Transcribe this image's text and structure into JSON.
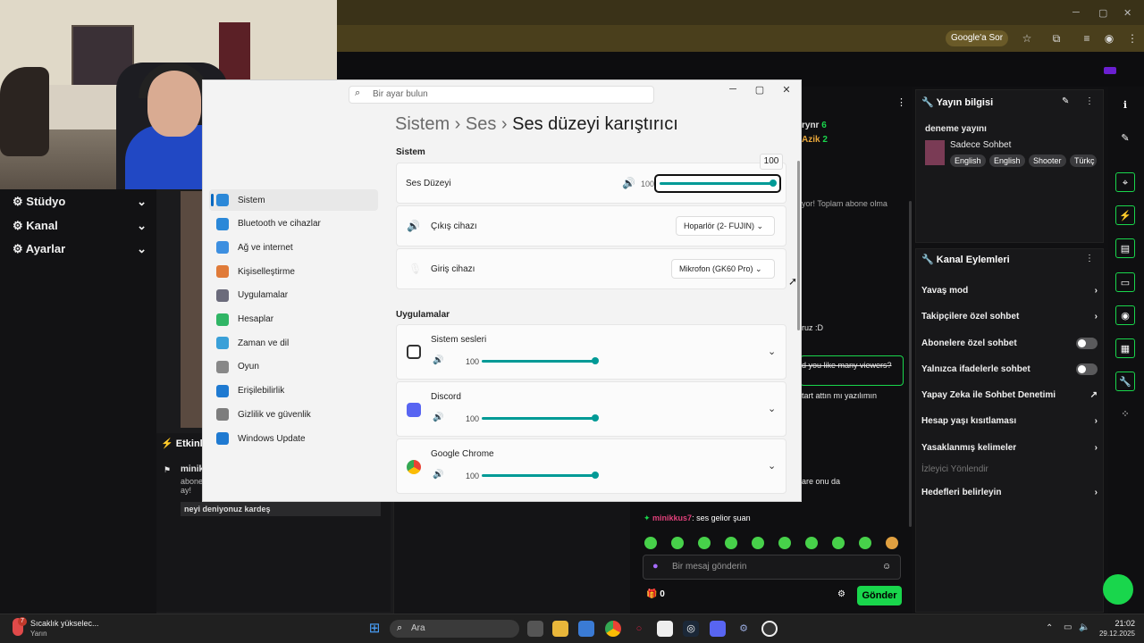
{
  "browser": {
    "ask_google": "Google'a Sor"
  },
  "left_nav": {
    "items": [
      {
        "label": "Stüdyo"
      },
      {
        "label": "Kanal"
      },
      {
        "label": "Ayarlar"
      }
    ]
  },
  "events": {
    "title": "Etkinlik",
    "user": "minik",
    "text": "abone ay!",
    "message": "neyi deniyonuz kardeş"
  },
  "chat": {
    "partial_url": "com",
    "top_users": [
      {
        "name": "rynr",
        "count": "6"
      },
      {
        "name": "Azik",
        "count": "2"
      }
    ],
    "lines": [
      "yor! Toplam abone olma",
      "ruz :D",
      "d you like many viewers?",
      "tart attın mı yazılımın",
      "are onu da",
      "gelior"
    ],
    "last_user": "minikkus7",
    "last_msg": ": ses gelior şuan",
    "input_placeholder": "Bir mesaj gönderin",
    "points": "0",
    "send": "Gönder"
  },
  "stream_info": {
    "title": "Yayın bilgisi",
    "stream_title": "deneme yayını",
    "category": "Sadece Sohbet",
    "tags": [
      "English",
      "English",
      "Shooter",
      "Türkç"
    ]
  },
  "channel_actions": {
    "title": "Kanal Eylemleri",
    "rows": [
      {
        "label": "Yavaş mod",
        "control": "arrow"
      },
      {
        "label": "Takipçilere özel sohbet",
        "control": "arrow"
      },
      {
        "label": "Abonelere özel sohbet",
        "control": "toggle"
      },
      {
        "label": "Yalnızca ifadelerle sohbet",
        "control": "toggle"
      },
      {
        "label": "Yapay Zeka ile Sohbet Denetimi",
        "control": "external"
      },
      {
        "label": "Hesap yaşı kısıtlaması",
        "control": "arrow"
      },
      {
        "label": "Yasaklanmış kelimeler",
        "control": "arrow"
      }
    ],
    "section": "İzleyici Yönlendir",
    "goal": "Hedefleri belirleyin"
  },
  "settings": {
    "search_placeholder": "Bir ayar bulun",
    "breadcrumb": [
      "Sistem",
      "Ses",
      "Ses düzeyi karıştırıcı"
    ],
    "sidebar": [
      {
        "label": "Sistem",
        "color": "#2b88d8"
      },
      {
        "label": "Bluetooth ve cihazlar",
        "color": "#2b88d8"
      },
      {
        "label": "Ağ ve internet",
        "color": "#3d8fe0"
      },
      {
        "label": "Kişiselleştirme",
        "color": "#e07b39"
      },
      {
        "label": "Uygulamalar",
        "color": "#6b6b7b"
      },
      {
        "label": "Hesaplar",
        "color": "#30b565"
      },
      {
        "label": "Zaman ve dil",
        "color": "#3aa0d8"
      },
      {
        "label": "Oyun",
        "color": "#888"
      },
      {
        "label": "Erişilebilirlik",
        "color": "#1f7ad1"
      },
      {
        "label": "Gizlilik ve güvenlik",
        "color": "#7d7d7d"
      },
      {
        "label": "Windows Update",
        "color": "#1f7ad1"
      }
    ],
    "system_section": "Sistem",
    "master_volume": {
      "label": "Ses Düzeyi",
      "value": "100",
      "tooltip": "100",
      "level": 1.0
    },
    "output": {
      "label": "Çıkış cihazı",
      "value": "Hoparlör (2- FUJIN)"
    },
    "input": {
      "label": "Giriş cihazı",
      "value": "Mikrofon (GK60 Pro)"
    },
    "apps_section": "Uygulamalar",
    "apps": [
      {
        "name": "Sistem sesleri",
        "value": "100",
        "level": 1.0
      },
      {
        "name": "Discord",
        "value": "100",
        "level": 1.0
      },
      {
        "name": "Google Chrome",
        "value": "100",
        "level": 1.0
      }
    ]
  },
  "taskbar": {
    "weather": "Sıcaklık yükselec...",
    "weather_sub": "Yarın",
    "weather_badge": "7",
    "search": "Ara",
    "time": "21:02",
    "date": "29.12.2025"
  }
}
